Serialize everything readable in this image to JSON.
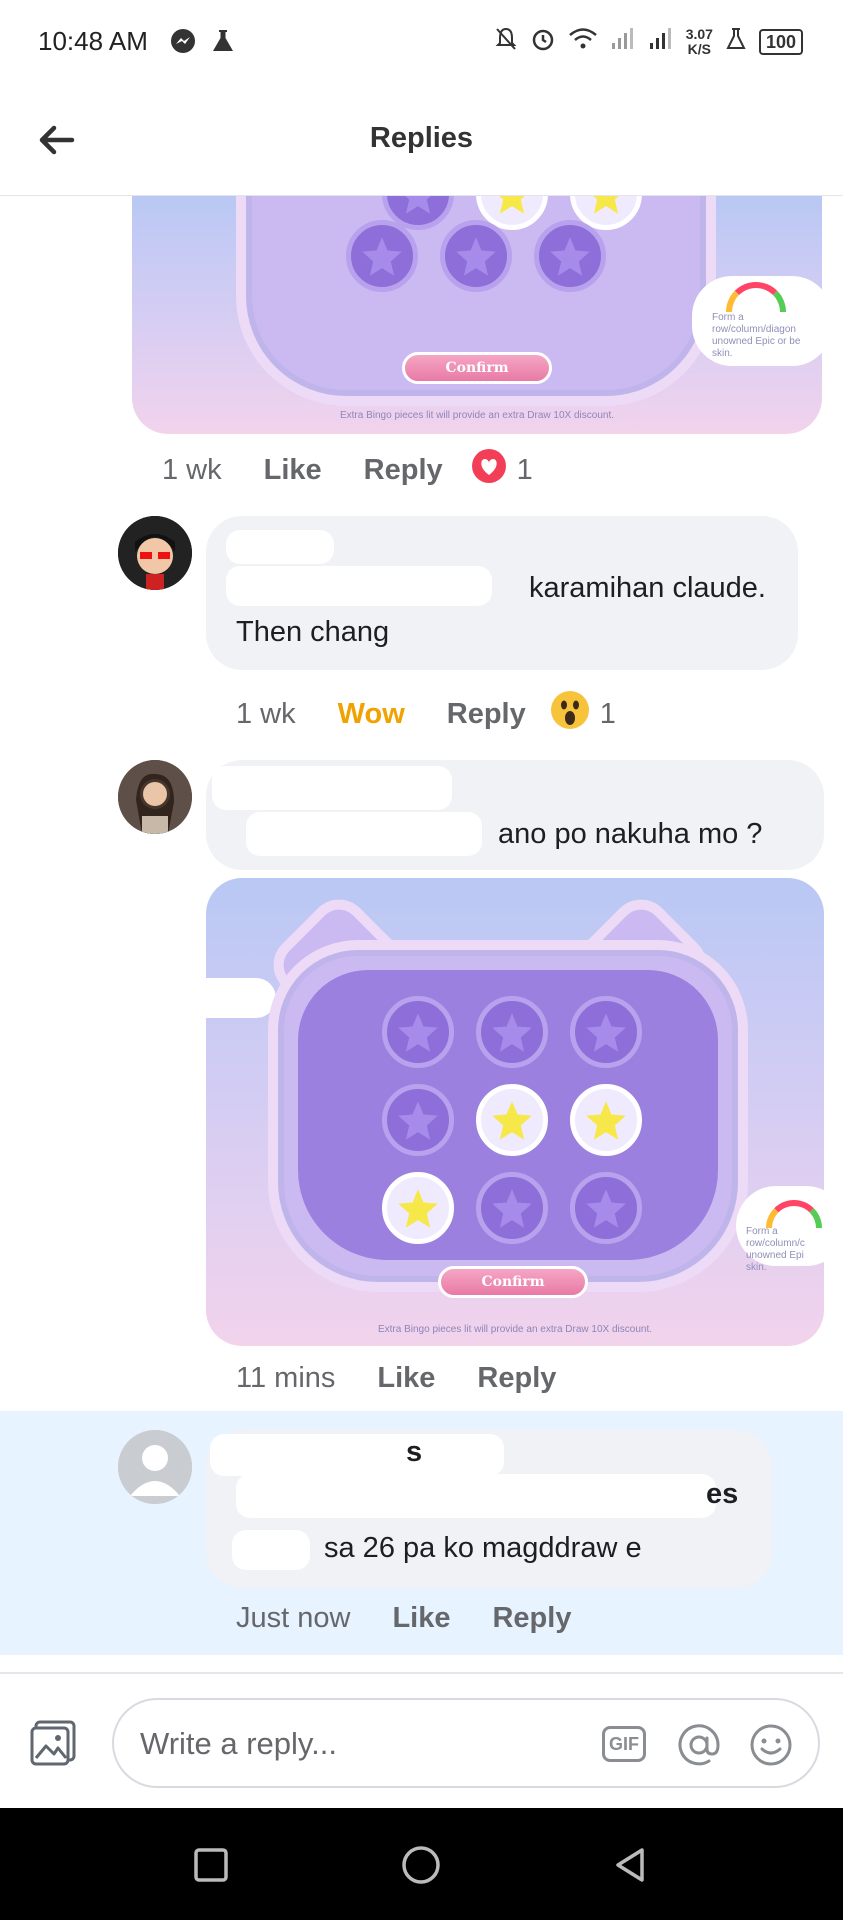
{
  "status_bar": {
    "time": "10:48 AM",
    "net_speed_value": "3.07",
    "net_speed_unit": "K/S",
    "battery": "100"
  },
  "header": {
    "title": "Replies"
  },
  "game_image": {
    "confirm": "Confirm",
    "footnote": "Extra Bingo pieces lit will provide an extra Draw 10X discount.",
    "tip_1": "Form a",
    "tip_2": "row/column/diagon",
    "tip_3": "unowned Epic or be",
    "tip_4": "skin."
  },
  "game_image_2": {
    "tip_2": "row/column/c",
    "tip_3": "unowned Epi"
  },
  "top_post_meta": {
    "time": "1 wk",
    "like": "Like",
    "reply": "Reply",
    "reaction_count": "1"
  },
  "comments": [
    {
      "line1": "karamihan claude.",
      "line2": "Then chang",
      "time": "1 wk",
      "reaction_label": "Wow",
      "reply": "Reply",
      "reaction_count": "1"
    },
    {
      "line1": "ano po nakuha mo ?",
      "time": "11 mins",
      "like": "Like",
      "reply": "Reply"
    },
    {
      "line1_end": "s",
      "line2_end": "es",
      "line3": "sa 26 pa ko magddraw e",
      "time": "Just now",
      "like": "Like",
      "reply": "Reply"
    }
  ],
  "composer": {
    "placeholder": "Write a reply...",
    "gif": "GIF"
  },
  "colors": {
    "wow": "#f0a200",
    "love": "#f33e58",
    "highlight": "#e7f3ff",
    "bubble": "#f0f2f5"
  }
}
